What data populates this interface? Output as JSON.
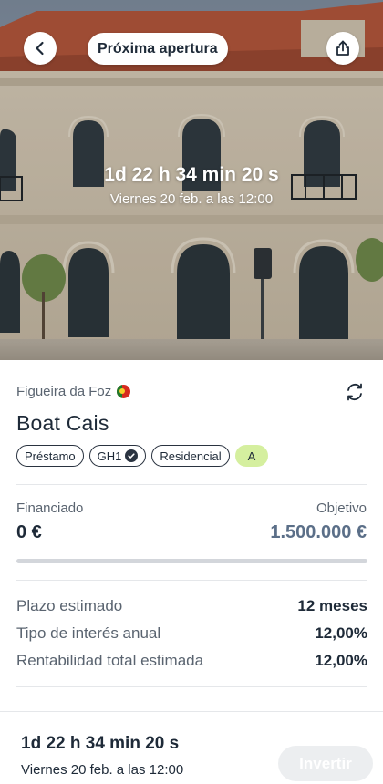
{
  "header": {
    "back_icon": "chevron-left-icon",
    "status_pill": "Próxima apertura",
    "share_icon": "share-icon"
  },
  "hero": {
    "countdown": "1d 22 h 34 min 20 s",
    "date": "Viernes 20 feb. a las 12:00"
  },
  "project": {
    "location": "Figueira da Foz",
    "flag": "portugal-flag-icon",
    "name": "Boat Cais",
    "tags": [
      "Préstamo",
      "GH1",
      "Residencial"
    ],
    "grade": "A"
  },
  "funding": {
    "financed_label": "Financiado",
    "financed_value": "0 €",
    "target_label": "Objetivo",
    "target_value": "1.500.000 €",
    "progress_fraction": 0
  },
  "details": [
    {
      "label": "Plazo estimado",
      "value": "12 meses"
    },
    {
      "label": "Tipo de interés anual",
      "value": "12,00%"
    },
    {
      "label": "Rentabilidad total estimada",
      "value": "12,00%"
    }
  ],
  "footer": {
    "countdown": "1d 22 h 34 min 20 s",
    "date": "Viernes 20 feb. a las 12:00",
    "invest_label": "Invertir"
  },
  "colors": {
    "grade_badge": "#d5ef9f",
    "target_value": "#5b6f88",
    "invest_button_disabled": "#eceef0"
  }
}
